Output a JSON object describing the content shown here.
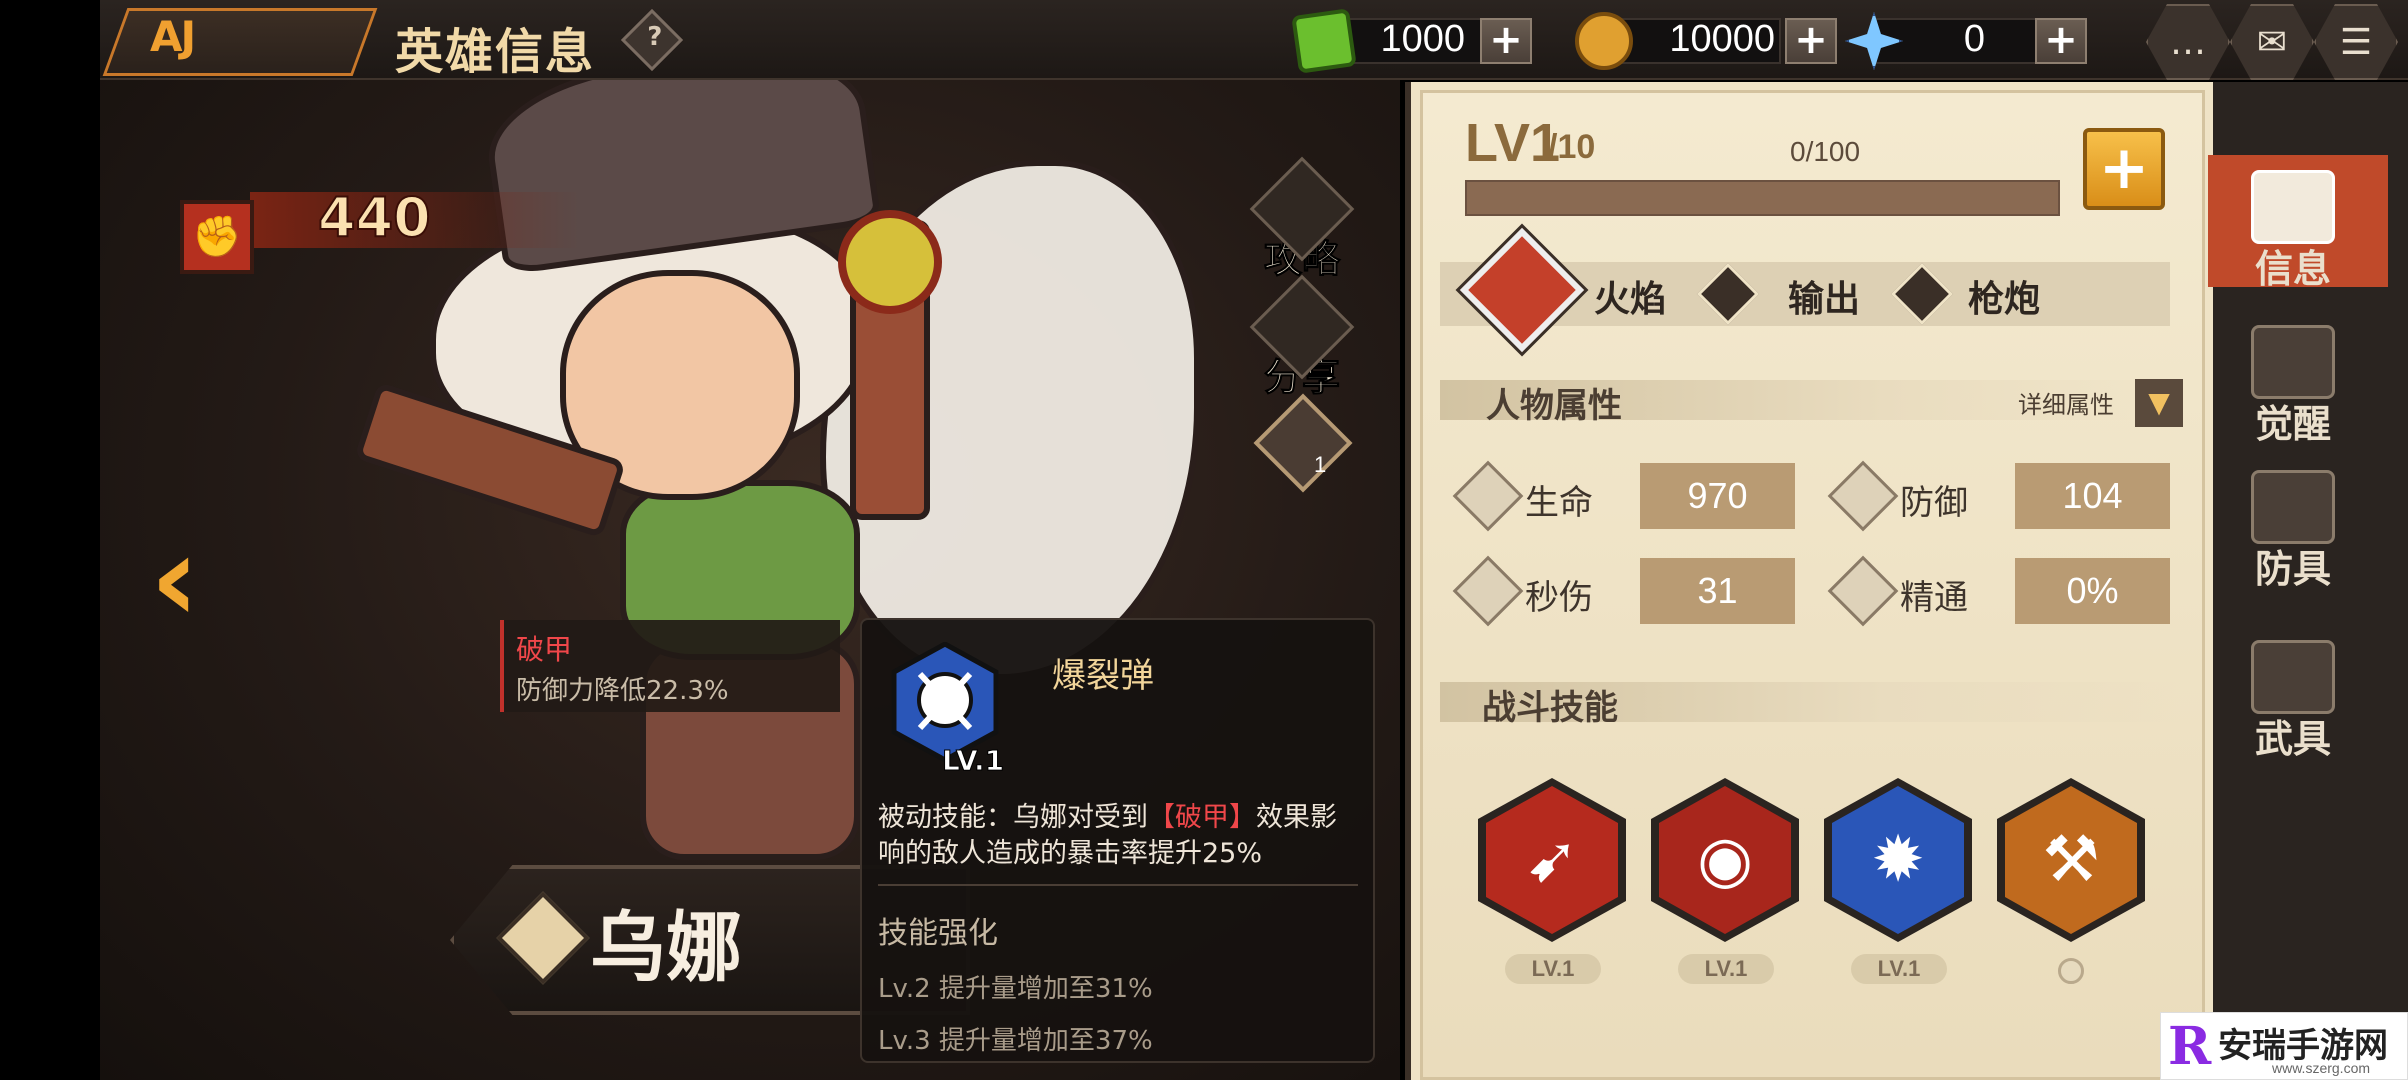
{
  "header": {
    "title": "英雄信息",
    "help_glyph": "?",
    "logo_text": "AJ"
  },
  "currencies": [
    {
      "name": "green-gem",
      "value": "1000",
      "plus": "+",
      "color": "#6bbf2e"
    },
    {
      "name": "gold-coin",
      "value": "10000",
      "plus": "+",
      "color": "#e0a030"
    },
    {
      "name": "crystal-star",
      "value": "0",
      "plus": "+",
      "color": "#7fc7ff"
    }
  ],
  "top_buttons": [
    {
      "name": "chat-icon",
      "glyph": "…"
    },
    {
      "name": "mail-icon",
      "glyph": "✉"
    },
    {
      "name": "menu-icon",
      "glyph": "☰"
    }
  ],
  "hero": {
    "power_icon": "fist-icon",
    "power": "440",
    "name": "乌娜"
  },
  "quick_actions": [
    {
      "label": "攻略",
      "icon": "guide-book-icon"
    },
    {
      "label": "分享",
      "icon": "share-icon"
    },
    {
      "label": "",
      "icon": "heart-emblem-icon",
      "count": "1"
    }
  ],
  "debuff": {
    "name": "破甲",
    "description": "防御力降低22.3%"
  },
  "tooltip": {
    "skill_name": "爆裂弹",
    "skill_level": "LV.1",
    "desc_prefix": "被动技能：乌娜对受到",
    "desc_highlight": "【破甲】",
    "desc_suffix": "效果影响的敌人造成的暴击率提升25%",
    "enhance_title": "技能强化",
    "enhance_1": "Lv.2  提升量增加至31%",
    "enhance_2": "Lv.3  提升量增加至37%"
  },
  "level": {
    "level": "LV1",
    "max": "/10",
    "exp": "0/100",
    "exp_fraction": 0,
    "plus": "+"
  },
  "tags": [
    {
      "label": "火焰",
      "icon": "flame-icon"
    },
    {
      "label": "输出",
      "icon": "damage-icon"
    },
    {
      "label": "枪炮",
      "icon": "gun-icon"
    }
  ],
  "attributes": {
    "title": "人物属性",
    "detail_label": "详细属性",
    "detail_glyph": "▼",
    "stats": [
      {
        "label": "生命",
        "value": "970",
        "icon": "health-icon"
      },
      {
        "label": "防御",
        "value": "104",
        "icon": "shield-icon"
      },
      {
        "label": "秒伤",
        "value": "31",
        "icon": "dps-icon"
      },
      {
        "label": "精通",
        "value": "0%",
        "icon": "mastery-icon"
      }
    ]
  },
  "skills": {
    "title": "战斗技能",
    "items": [
      {
        "name": "skill-rockets",
        "glyph": "➹",
        "level": "LV.1",
        "color": "#b52a1e"
      },
      {
        "name": "skill-grenade",
        "glyph": "◉",
        "level": "LV.1",
        "color": "#a8261c"
      },
      {
        "name": "skill-burst-shell",
        "glyph": "✹",
        "level": "LV.1",
        "color": "#2a56b8"
      },
      {
        "name": "skill-axe",
        "glyph": "⚒",
        "level": "",
        "color": "#c06a1e"
      }
    ]
  },
  "side_tabs": [
    {
      "label": "信息",
      "icon": "info-book-icon",
      "active": true
    },
    {
      "label": "觉醒",
      "icon": "awaken-icon",
      "active": false
    },
    {
      "label": "防具",
      "icon": "armor-icon",
      "active": false
    },
    {
      "label": "武具",
      "icon": "weapon-icon",
      "active": false
    }
  ],
  "watermark": {
    "logo": "R",
    "text": "安瑞手游网",
    "url": "www.szerg.com"
  }
}
